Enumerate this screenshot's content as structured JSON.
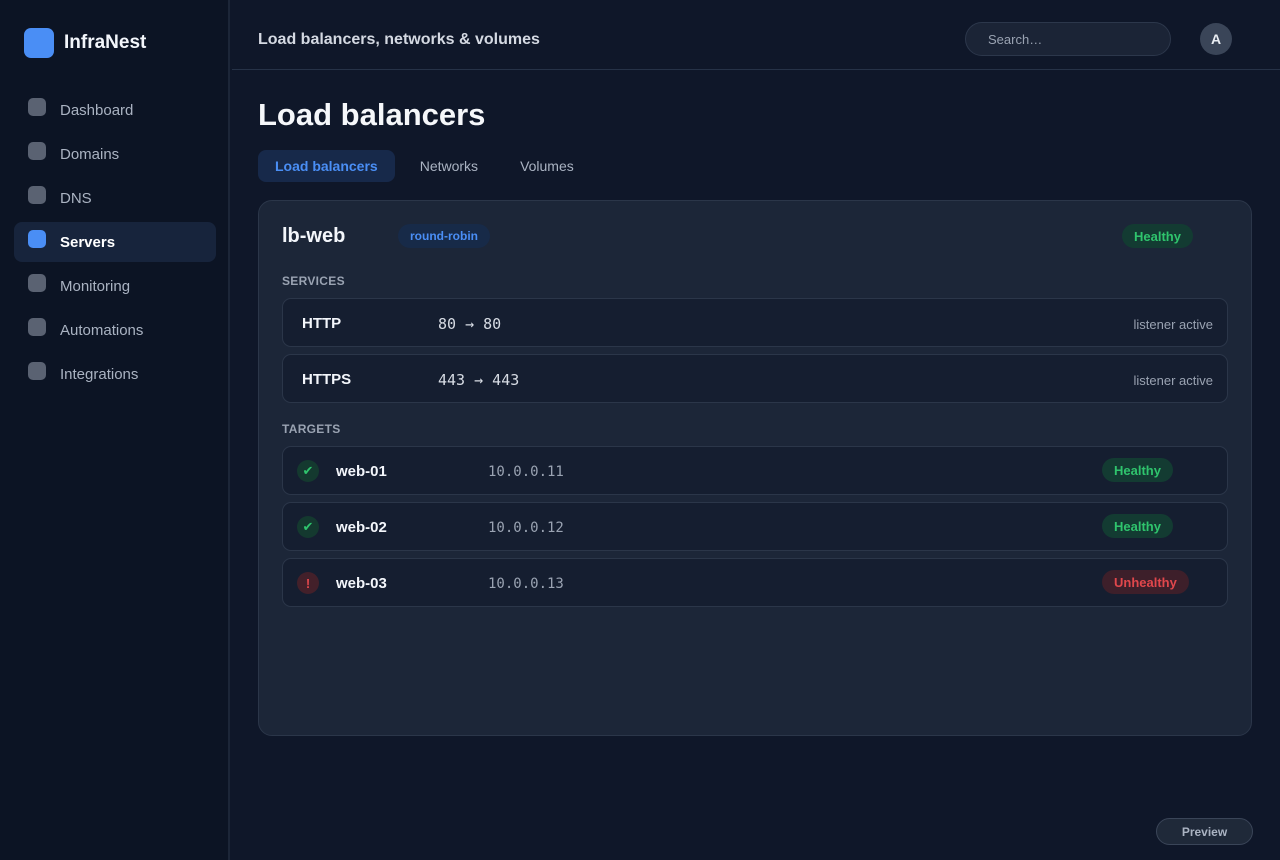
{
  "app": {
    "name": "InfraNest"
  },
  "sidebar": {
    "items": [
      {
        "label": "Dashboard",
        "active": false
      },
      {
        "label": "Domains",
        "active": false
      },
      {
        "label": "DNS",
        "active": false
      },
      {
        "label": "Servers",
        "active": true
      },
      {
        "label": "Monitoring",
        "active": false
      },
      {
        "label": "Automations",
        "active": false
      },
      {
        "label": "Integrations",
        "active": false
      }
    ]
  },
  "header": {
    "title": "Load balancers, networks & volumes",
    "search_placeholder": "Search…",
    "avatar_initial": "A"
  },
  "page": {
    "title": "Load balancers",
    "tabs": [
      {
        "label": "Load balancers",
        "active": true
      },
      {
        "label": "Networks",
        "active": false
      },
      {
        "label": "Volumes",
        "active": false
      }
    ]
  },
  "load_balancer": {
    "name": "lb-web",
    "algorithm": "round-robin",
    "status": "Healthy",
    "services_label": "SERVICES",
    "services": [
      {
        "protocol": "HTTP",
        "ports": "80 → 80",
        "state": "listener active"
      },
      {
        "protocol": "HTTPS",
        "ports": "443 → 443",
        "state": "listener active"
      }
    ],
    "targets_label": "TARGETS",
    "targets": [
      {
        "name": "web-01",
        "ip": "10.0.0.11",
        "status": "Healthy",
        "icon": "check-icon",
        "glyph": "✔"
      },
      {
        "name": "web-02",
        "ip": "10.0.0.12",
        "status": "Healthy",
        "icon": "check-icon",
        "glyph": "✔"
      },
      {
        "name": "web-03",
        "ip": "10.0.0.13",
        "status": "Unhealthy",
        "icon": "alert-icon",
        "glyph": "!"
      }
    ]
  },
  "footer": {
    "preview_label": "Preview"
  },
  "colors": {
    "accent": "#4a8ef5",
    "healthy": "#2fc46d",
    "unhealthy": "#e0474c",
    "background": "#0f1729",
    "card": "#1c2638"
  }
}
